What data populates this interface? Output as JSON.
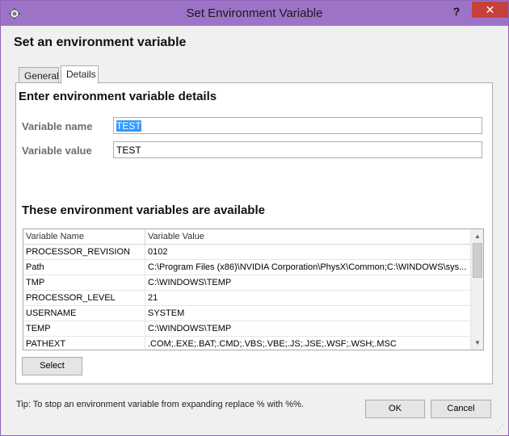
{
  "window": {
    "title": "Set Environment Variable",
    "help_label": "?",
    "close_label": "✕",
    "app_icon": "gear-icon"
  },
  "header": {
    "title": "Set an environment variable"
  },
  "tabs": [
    {
      "label": "General",
      "selected": false
    },
    {
      "label": "Details",
      "selected": true
    }
  ],
  "details": {
    "heading": "Enter environment variable details",
    "variable_name_label": "Variable name",
    "variable_name_value": "TEST",
    "variable_value_label": "Variable value",
    "variable_value_value": "TEST"
  },
  "available": {
    "heading": "These environment variables are available",
    "columns": [
      "Variable Name",
      "Variable Value"
    ],
    "rows": [
      {
        "name": "PROCESSOR_REVISION",
        "value": "0102"
      },
      {
        "name": "Path",
        "value": "C:\\Program Files (x86)\\NVIDIA Corporation\\PhysX\\Common;C:\\WINDOWS\\sys..."
      },
      {
        "name": "TMP",
        "value": "C:\\WINDOWS\\TEMP"
      },
      {
        "name": "PROCESSOR_LEVEL",
        "value": "21"
      },
      {
        "name": "USERNAME",
        "value": "SYSTEM"
      },
      {
        "name": "TEMP",
        "value": "C:\\WINDOWS\\TEMP"
      },
      {
        "name": "PATHEXT",
        "value": ".COM;.EXE;.BAT;.CMD;.VBS;.VBE;.JS;.JSE;.WSF;.WSH;.MSC"
      }
    ],
    "select_label": "Select"
  },
  "footer": {
    "tip": "Tip: To stop an environment variable from expanding replace % with %%.",
    "ok_label": "OK",
    "cancel_label": "Cancel"
  },
  "colors": {
    "titlebar": "#9d73c8",
    "close": "#c7403a",
    "selection": "#3399ff"
  }
}
